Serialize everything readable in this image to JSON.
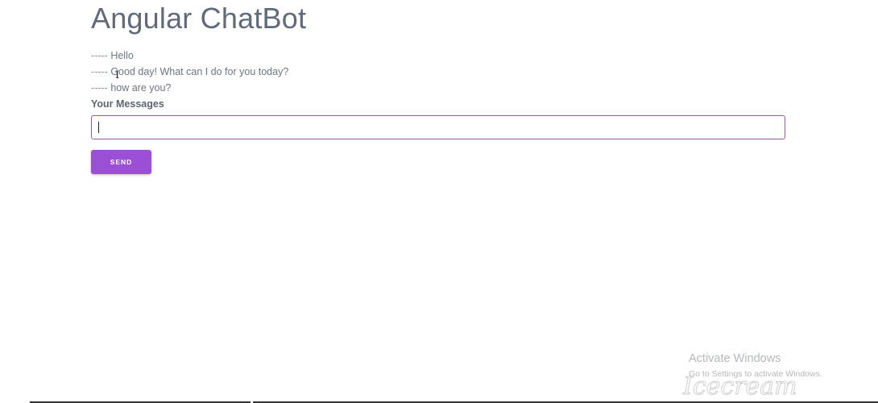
{
  "app": {
    "title": "Angular ChatBot"
  },
  "conversation": {
    "messages": [
      {
        "prefix": "-----",
        "text": "Hello"
      },
      {
        "prefix": "-----",
        "text": "Good day! What can I do for you today?"
      },
      {
        "prefix": "-----",
        "text": "how are you?"
      }
    ]
  },
  "composer": {
    "label": "Your Messages",
    "input_value": "",
    "send_label": "SEND"
  },
  "overlay": {
    "activate_title": "Activate Windows",
    "activate_subtitle": "Go to Settings to activate Windows.",
    "watermark_text": "Icecream"
  },
  "colors": {
    "accent": "#9b4fd6",
    "input_border": "#9c5aa8",
    "title_text": "#5f6b7a"
  }
}
